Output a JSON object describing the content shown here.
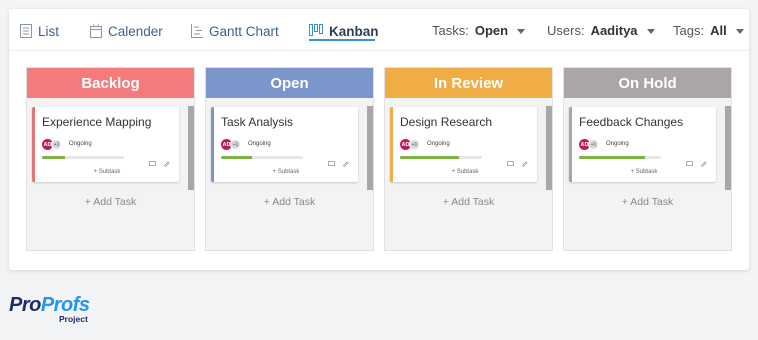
{
  "toolbar": {
    "views": [
      {
        "label": "List",
        "icon": "list-icon"
      },
      {
        "label": "Calender",
        "icon": "calendar-icon"
      },
      {
        "label": "Gantt Chart",
        "icon": "gantt-icon"
      },
      {
        "label": "Kanban",
        "icon": "kanban-icon"
      }
    ],
    "active_view": "Kanban",
    "filters": [
      {
        "label": "Tasks:",
        "value": "Open"
      },
      {
        "label": "Users:",
        "value": "Aaditya"
      },
      {
        "label": "Tags:",
        "value": "All"
      }
    ]
  },
  "columns": [
    {
      "name": "Backlog",
      "color": "#f47b7b",
      "card": {
        "title": "Experience Mapping",
        "avatar": "AD",
        "extra": "+1",
        "status": "Ongoing",
        "progress": 0.28,
        "accent": "#e87575",
        "subtask": "+ Subtask"
      },
      "add_task": "+ Add Task"
    },
    {
      "name": "Open",
      "color": "#7b96cb",
      "card": {
        "title": "Task Analysis",
        "avatar": "AD",
        "extra": "+1",
        "status": "Ongoing",
        "progress": 0.38,
        "accent": "#7b96cb",
        "subtask": "+ Subtask"
      },
      "add_task": "+ Add Task"
    },
    {
      "name": "In Review",
      "color": "#f0ac45",
      "card": {
        "title": "Design Research",
        "avatar": "AD",
        "extra": "+1",
        "status": "Ongoing",
        "progress": 0.72,
        "accent": "#f0ac45",
        "subtask": "+ Subtask"
      },
      "add_task": "+ Add Task"
    },
    {
      "name": "On Hold",
      "color": "#a9a6a5",
      "card": {
        "title": "Feedback Changes",
        "avatar": "AD",
        "extra": "+1",
        "status": "Ongoing",
        "progress": 0.8,
        "accent": "#a9a6a5",
        "subtask": "+ Subtask"
      },
      "add_task": "+ Add Task"
    }
  ],
  "logo": {
    "pro1": "Pro",
    "pro2": "Profs",
    "sub": "Project",
    "color_dark": "#1c2b6b",
    "color_accent": "#2196f3"
  }
}
